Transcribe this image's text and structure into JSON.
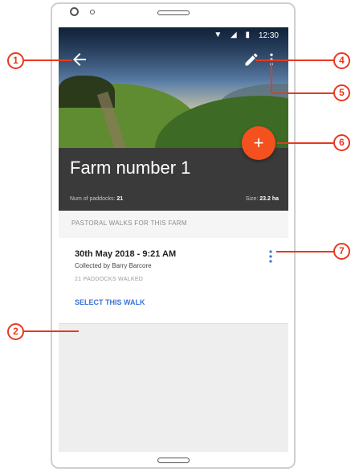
{
  "status_bar": {
    "time": "12:30",
    "icons": [
      "wifi-icon",
      "signal-icon",
      "battery-icon"
    ]
  },
  "header": {
    "back_icon": "arrow-back-icon",
    "edit_icon": "pencil-icon",
    "more_icon": "more-vert-icon"
  },
  "farm": {
    "title": "Farm number 1",
    "paddocks_label": "Num of paddocks:",
    "paddocks_value": "21",
    "size_label": "Size:",
    "size_value": "23.2 ha"
  },
  "fab": {
    "label": "+",
    "icon": "add-icon",
    "color": "#f4511e"
  },
  "section": {
    "header": "PASTORAL WALKS FOR THIS FARM"
  },
  "walks": [
    {
      "title": "30th May 2018 - 9:21 AM",
      "collected_by": "Collected by Barry Barcore",
      "paddocks_walked": "21 PADDOCKS WALKED",
      "action": "SELECT THIS WALK"
    }
  ],
  "callouts": [
    "1",
    "2",
    "4",
    "5",
    "6",
    "7"
  ],
  "colors": {
    "accent": "#f4511e",
    "link": "#3c73d6",
    "callout": "#e8381f",
    "title_band": "#3a3a3a"
  }
}
